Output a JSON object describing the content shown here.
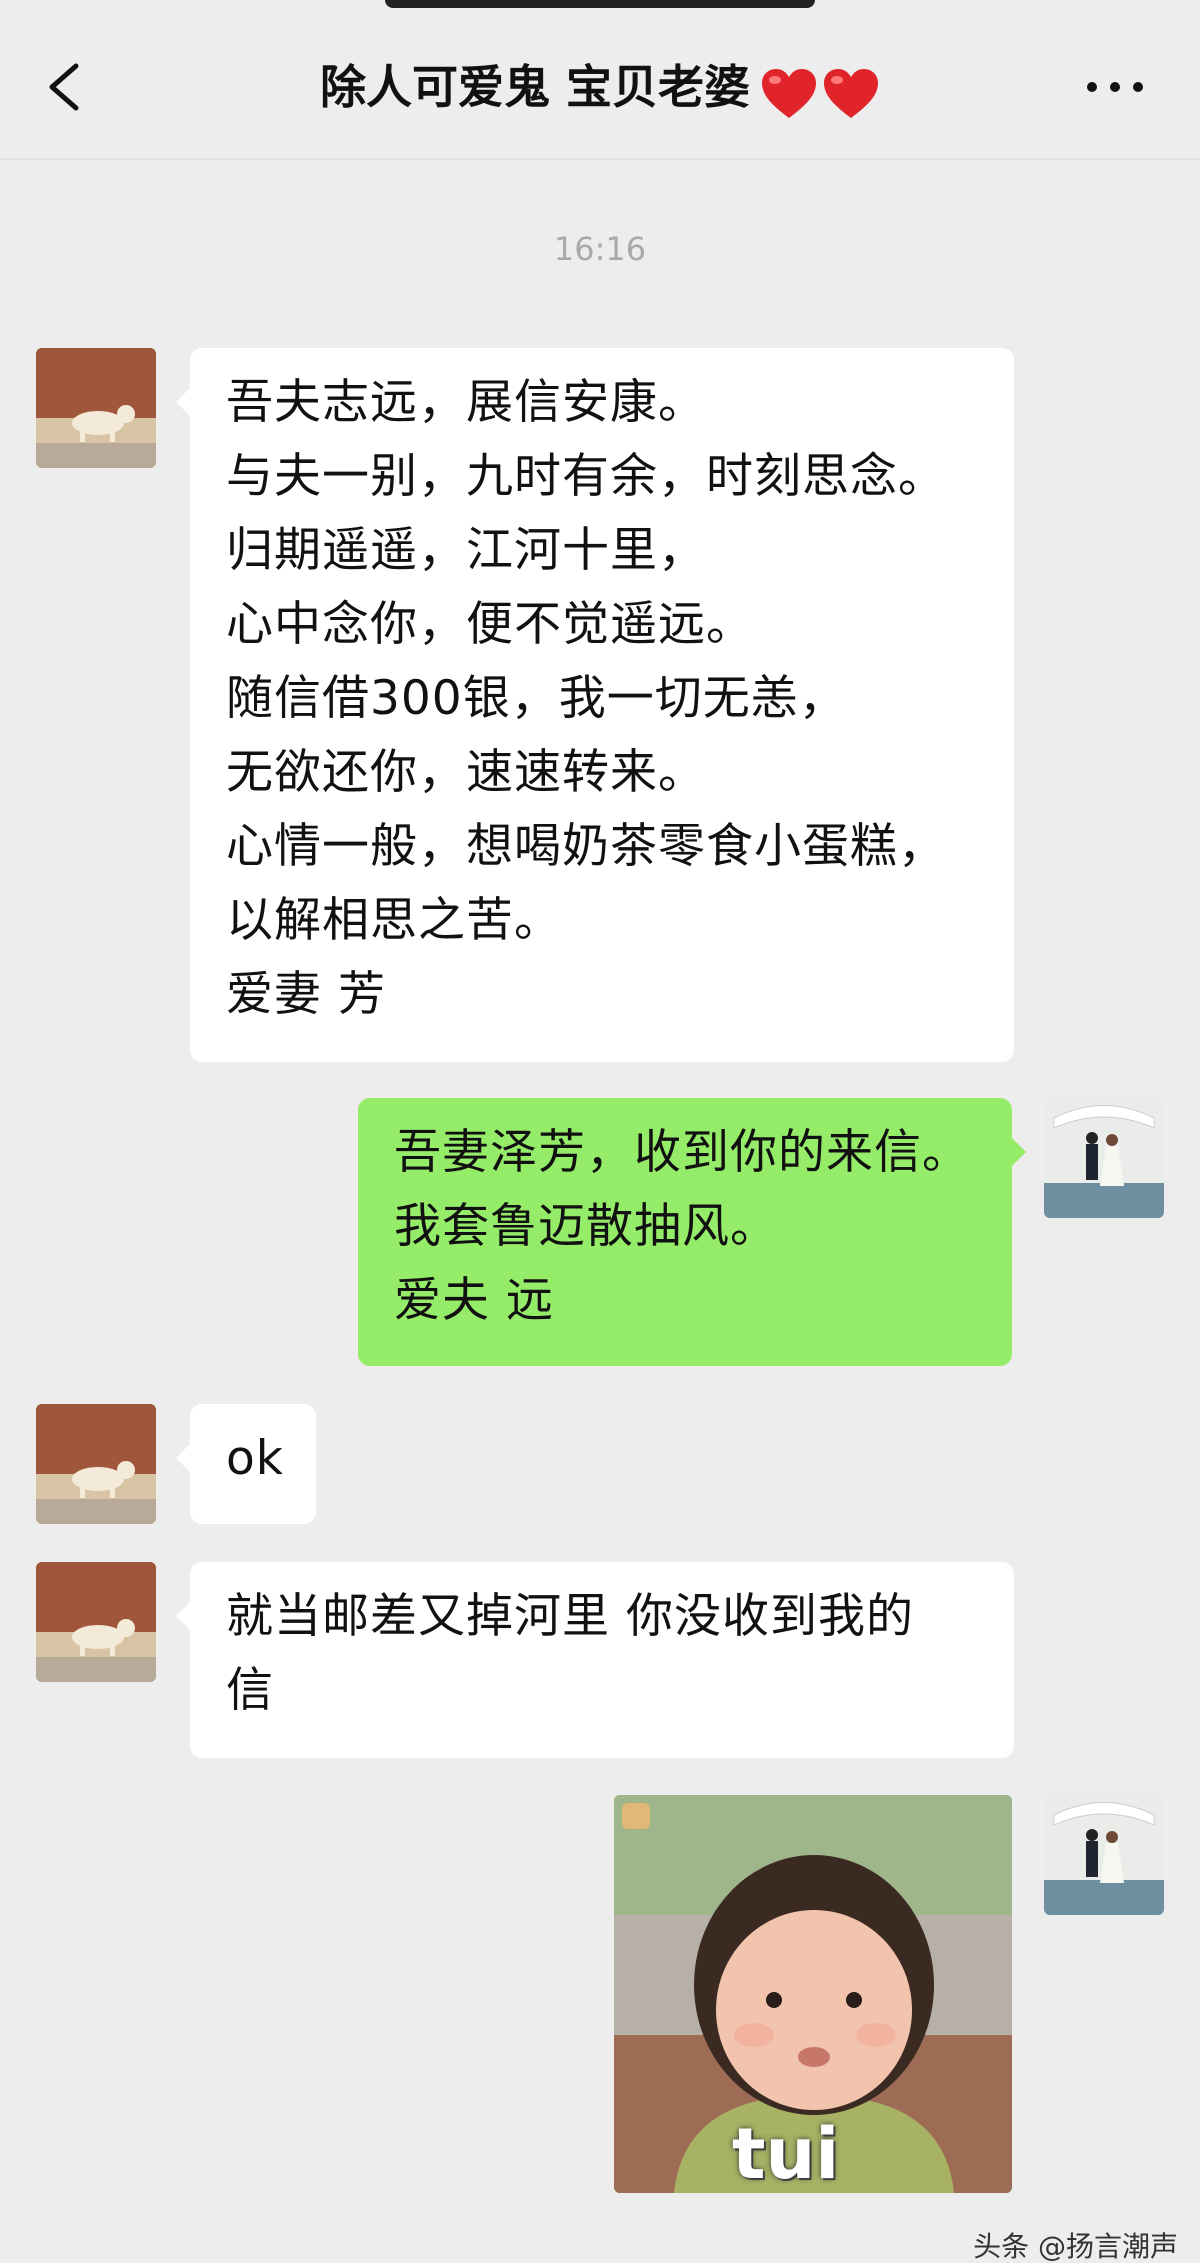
{
  "header": {
    "title": "除人可爱鬼 宝贝老婆",
    "back_icon": "chevron-left-icon",
    "more_icon": "more-dots-icon",
    "heart_icon": "red-heart-icon",
    "heart_color": "#e0242a"
  },
  "chat": {
    "timestamp": "16:16",
    "messages": [
      {
        "side": "incoming",
        "lines": [
          "吾夫志远，展信安康。",
          "与夫一别，九时有余，时刻思念。",
          "归期遥遥，江河十里，",
          "心中念你，便不觉遥远。",
          "随信借300银，我一切无恙，",
          "无欲还你，速速转来。",
          "心情一般，想喝奶茶零食小蛋糕，",
          "以解相思之苦。",
          "爱妻 芳"
        ]
      },
      {
        "side": "outgoing",
        "lines": [
          "吾妻泽芳，收到你的来信。",
          "我套鲁迈散抽风。",
          "爱夫 远"
        ]
      },
      {
        "side": "incoming",
        "lines": [
          "ok"
        ]
      },
      {
        "side": "incoming",
        "lines": [
          "就当邮差又掉河里  你没收到我的",
          "信"
        ]
      },
      {
        "side": "outgoing",
        "type": "sticker",
        "caption": "tui"
      }
    ]
  },
  "colors": {
    "background": "#ededed",
    "incoming_bubble": "#ffffff",
    "outgoing_bubble": "#95ec69"
  },
  "watermark": "头条 @扬言潮声"
}
